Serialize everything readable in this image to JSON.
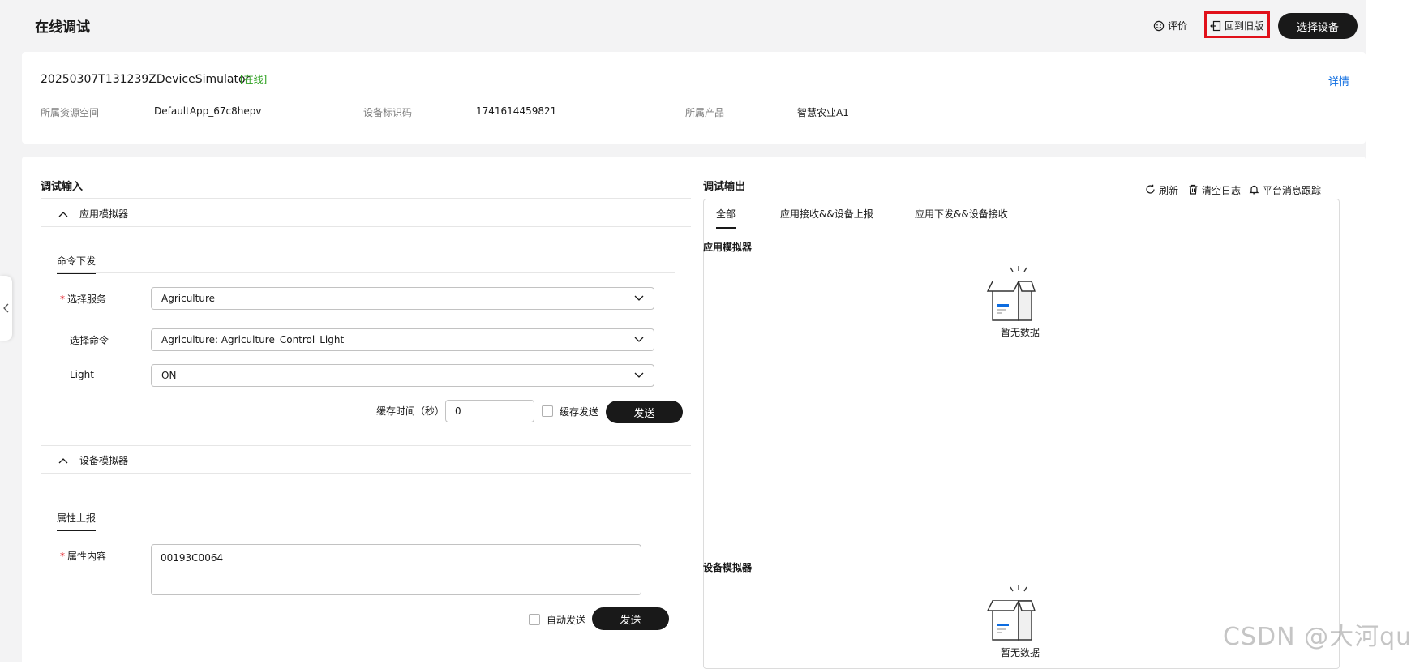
{
  "header": {
    "title": "在线调试",
    "rate_label": "评价",
    "rate_icon": "smile-icon",
    "back_old_label": "回到旧版",
    "back_old_icon": "exit-icon",
    "select_device_label": "选择设备"
  },
  "device": {
    "name": "20250307T131239ZDeviceSimulator",
    "status": "[在线]",
    "detail_link": "详情",
    "meta": [
      {
        "label": "所属资源空间",
        "value": "DefaultApp_67c8hepv"
      },
      {
        "label": "设备标识码",
        "value": "1741614459821"
      },
      {
        "label": "所属产品",
        "value": "智慧农业A1"
      }
    ]
  },
  "debug_input": {
    "title": "调试输入",
    "app_simulator": {
      "label": "应用模拟器",
      "tab": "命令下发",
      "service_label": "选择服务",
      "service_value": "Agriculture",
      "command_label": "选择命令",
      "command_value": "Agriculture: Agriculture_Control_Light",
      "param_label": "Light",
      "param_value": "ON",
      "cache_time_label": "缓存时间（秒）",
      "cache_time_value": "0",
      "cache_send_label": "缓存发送",
      "send_label": "发送"
    },
    "device_simulator": {
      "label": "设备模拟器",
      "tab": "属性上报",
      "content_label": "属性内容",
      "content_value": "00193C0064",
      "auto_send_label": "自动发送",
      "send_label": "发送"
    }
  },
  "debug_output": {
    "title": "调试输出",
    "tools": [
      {
        "label": "刷新",
        "icon": "refresh-icon"
      },
      {
        "label": "清空日志",
        "icon": "trash-icon"
      },
      {
        "label": "平台消息跟踪",
        "icon": "bell-icon"
      }
    ],
    "tabs": [
      {
        "label": "全部",
        "active": true
      },
      {
        "label": "应用接收&&设备上报",
        "active": false
      },
      {
        "label": "应用下发&&设备接收",
        "active": false
      }
    ],
    "app_section_label": "应用模拟器",
    "device_section_label": "设备模拟器",
    "empty_text": "暂无数据"
  },
  "watermark": "CSDN @大河qu",
  "colors": {
    "accent_dark": "#191919",
    "online_green": "#2ea121",
    "link_blue": "#0d6ce0",
    "required_red": "#e0101a",
    "highlight_red": "#e0101a",
    "empty_icon_blue": "#0d6ce0"
  }
}
